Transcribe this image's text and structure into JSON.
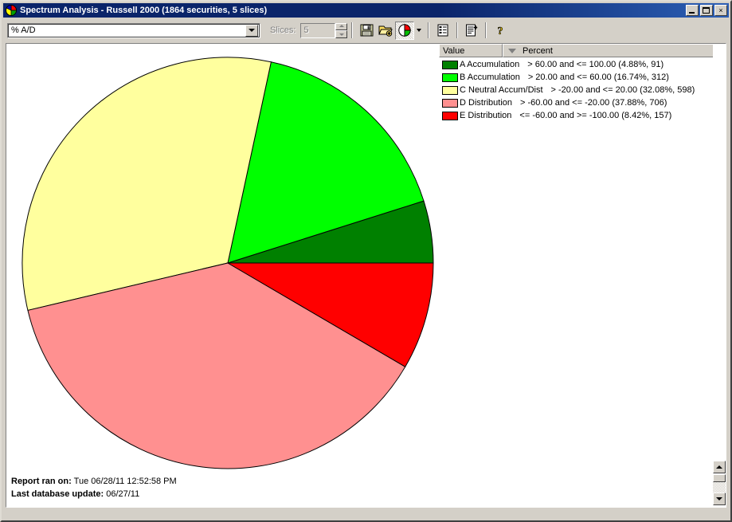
{
  "window": {
    "title": "Spectrum Analysis - Russell 2000 (1864 securities, 5 slices)",
    "app_icon": "pie-chart-icon",
    "minimize_label": "",
    "maximize_label": "",
    "close_label": "×"
  },
  "toolbar": {
    "metric_select_value": "% A/D",
    "metric_select_icon": "chevron-down-icon",
    "slices_label": "Slices:",
    "slices_value": "5",
    "buttons": [
      {
        "name": "save-button",
        "icon": "floppy-disk-icon",
        "label": "Save"
      },
      {
        "name": "open-button",
        "icon": "open-folder-icon",
        "label": "Open"
      },
      {
        "name": "pie-chart-view-button",
        "icon": "pie-chart-icon",
        "label": "Pie Chart View"
      },
      {
        "name": "pie-chart-view-dropdown",
        "icon": "chevron-down-icon",
        "label": "Chart Options"
      },
      {
        "name": "report-view-button",
        "icon": "list-report-icon",
        "label": "Report View"
      },
      {
        "name": "add-report-button",
        "icon": "list-add-icon",
        "label": "Add Report"
      },
      {
        "name": "help-button",
        "icon": "question-mark-icon",
        "label": "Help"
      }
    ]
  },
  "legend": {
    "columns": [
      "Value",
      "Percent"
    ],
    "sort_indicator": "descending-sort-icon",
    "rows": [
      {
        "label": "A Accumulation",
        "range": "> 60.00 and <= 100.00 (4.88%, 91)",
        "color": "#008000"
      },
      {
        "label": "B Accumulation",
        "range": "> 20.00 and <= 60.00 (16.74%, 312)",
        "color": "#00ff00"
      },
      {
        "label": "C Neutral Accum/Dist",
        "range": "> -20.00 and <= 20.00 (32.08%, 598)",
        "color": "#ffff9e"
      },
      {
        "label": "D Distribution",
        "range": "> -60.00 and <= -20.00 (37.88%, 706)",
        "color": "#ff9090"
      },
      {
        "label": "E Distribution",
        "range": "<= -60.00 and >= -100.00 (8.42%, 157)",
        "color": "#ff0000"
      }
    ]
  },
  "footer": {
    "report_ran_label": "Report ran on:",
    "report_ran_value": "Tue 06/28/11 12:52:58 PM",
    "db_update_label": "Last database update:",
    "db_update_value": "06/27/11"
  },
  "scrollbar": {
    "up_icon": "arrow-up-icon",
    "down_icon": "arrow-down-icon"
  },
  "chart_data": {
    "type": "pie",
    "title": "Spectrum Analysis - Russell 2000",
    "total_securities": 1864,
    "slice_count": 5,
    "start_angle_deg": 0,
    "direction": "counterclockwise",
    "center": [
      278,
      275
    ],
    "radius": 258,
    "categories": [
      "A Accumulation",
      "B Accumulation",
      "C Neutral Accum/Dist",
      "D Distribution",
      "E Distribution"
    ],
    "values": [
      4.88,
      16.74,
      32.08,
      37.88,
      8.42
    ],
    "counts": [
      91,
      312,
      598,
      706,
      157
    ],
    "colors": [
      "#008000",
      "#00ff00",
      "#ffff9e",
      "#ff9090",
      "#ff0000"
    ],
    "ranges": [
      "> 60.00 and <= 100.00",
      "> 20.00 and <= 60.00",
      "> -20.00 and <= 20.00",
      "> -60.00 and <= -20.00",
      "<= -60.00 and >= -100.00"
    ],
    "ylabel": "",
    "xlabel": "",
    "legend_position": "right"
  }
}
